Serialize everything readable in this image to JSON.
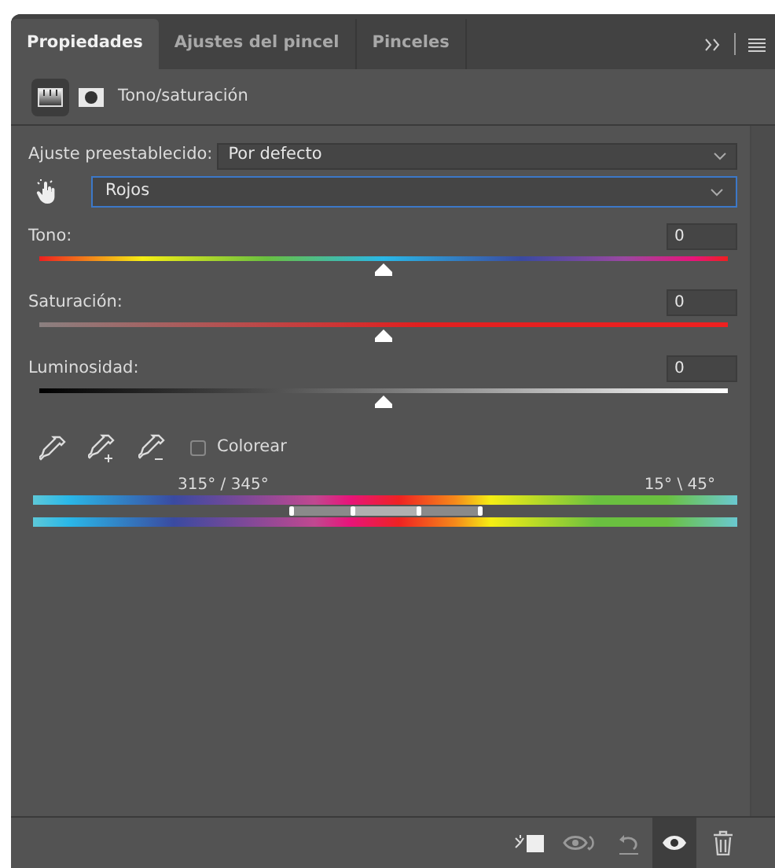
{
  "tabs": [
    {
      "label": "Propiedades",
      "selected": true
    },
    {
      "label": "Ajustes del pincel",
      "selected": false
    },
    {
      "label": "Pinceles",
      "selected": false
    }
  ],
  "header": {
    "title": "Tono/saturación"
  },
  "preset": {
    "label": "Ajuste preestablecido:",
    "value": "Por defecto"
  },
  "range_select": {
    "value": "Rojos"
  },
  "sliders": [
    {
      "kind": "hue",
      "label": "Tono:",
      "value": "0",
      "level": 0.5
    },
    {
      "kind": "saturation",
      "label": "Saturación:",
      "value": "0",
      "level": 0.5
    },
    {
      "kind": "lightness",
      "label": "Luminosidad:",
      "value": "0",
      "level": 0.5
    }
  ],
  "colorize": {
    "label": "Colorear",
    "checked": false
  },
  "color_range": {
    "left_label": "315° / 345°",
    "right_label": "15° \\ 45°",
    "handles": [
      {
        "level": 0.365
      },
      {
        "level": 0.454
      },
      {
        "level": 0.546
      },
      {
        "level": 0.633
      }
    ]
  },
  "toolbar": {
    "visibility_on": true
  }
}
